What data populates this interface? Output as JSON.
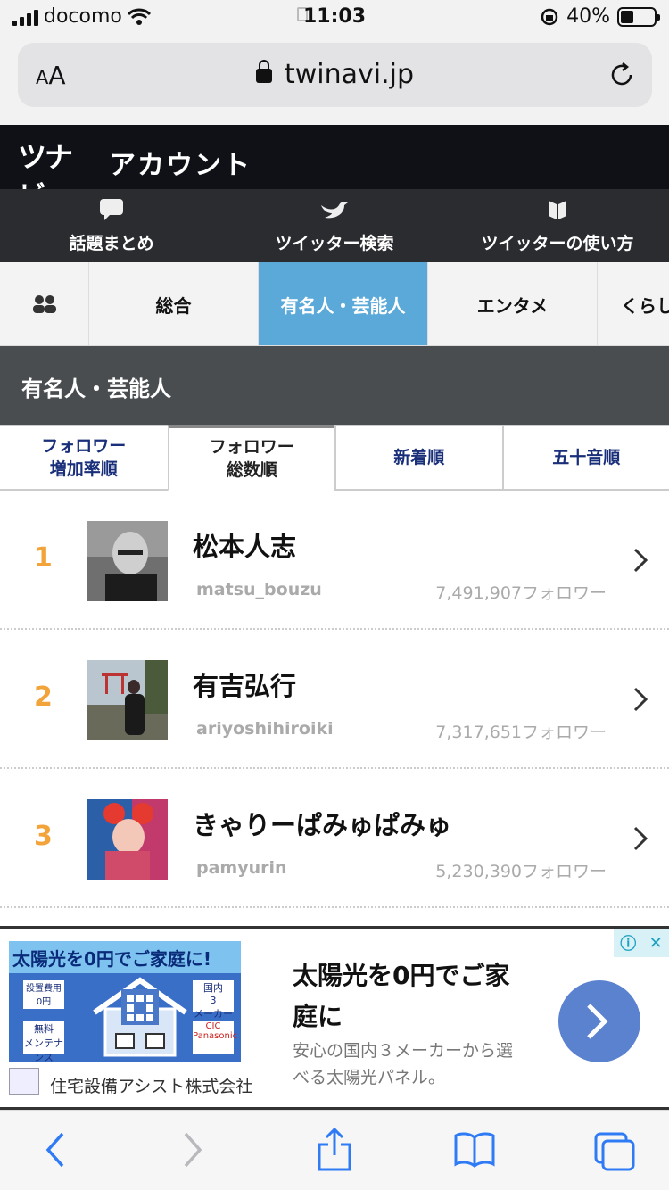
{
  "status_bar": {
    "carrier": "docomo",
    "time": "11:03",
    "battery_text": "40%",
    "battery_level": 0.4
  },
  "browser": {
    "text_size_label_small": "A",
    "text_size_label_large": "A",
    "host": "twinavi.jp"
  },
  "site": {
    "logo_text": "ツナビ",
    "header_title": "アカウント",
    "nav": [
      {
        "label": "話題まとめ",
        "icon": "speech-bubble-icon"
      },
      {
        "label": "ツイッター検索",
        "icon": "bird-icon"
      },
      {
        "label": "ツイッターの使い方",
        "icon": "book-leaf-icon"
      }
    ],
    "category_tabs": [
      {
        "label": "総合"
      },
      {
        "label": "有名人・芸能人",
        "active": true
      },
      {
        "label": "エンタメ"
      },
      {
        "label": "くらし"
      }
    ],
    "section_title": "有名人・芸能人",
    "sort_tabs": [
      {
        "label": "フォロワー\n増加率順"
      },
      {
        "label": "フォロワー\n総数順",
        "active": true
      },
      {
        "label": "新着順"
      },
      {
        "label": "五十音順"
      }
    ]
  },
  "ranking": [
    {
      "rank": "1",
      "name": "松本人志",
      "handle": "matsu_bouzu",
      "followers": "7,491,907フォロワー"
    },
    {
      "rank": "2",
      "name": "有吉弘行",
      "handle": "ariyoshihiroiki",
      "followers": "7,317,651フォロワー"
    },
    {
      "rank": "3",
      "name": "きゃりーぱみゅぱみゅ",
      "handle": "pamyurin",
      "followers": "5,230,390フォロワー"
    }
  ],
  "ad": {
    "banner_header": "太陽光を0円でご家庭に!",
    "banner_box1_line1": "設置費用",
    "banner_box1_line2": "0円",
    "banner_box2_line1": "無料",
    "banner_box2_line2": "メンテナンス",
    "banner_box3_line1": "国内",
    "banner_box3_line2": "3",
    "banner_box3_line3": "メーカー",
    "banner_box4_line1": "CIC",
    "banner_box4_line2": "Panasonic",
    "company": "住宅設備アシスト株式会社",
    "headline": "太陽光を0円でご家庭に",
    "description": "安心の国内３メーカーから選べる太陽光パネル。",
    "adchoice_info": "ⓘ",
    "adchoice_close": "✕"
  },
  "colors": {
    "rank": "#f2a43a",
    "active_category": "#5aa9d8",
    "sort_tab_text": "#1a2f7a",
    "header_bg": "#0f1116",
    "cta": "#5b82cf",
    "toolbar_icon": "#2f7bf5"
  }
}
